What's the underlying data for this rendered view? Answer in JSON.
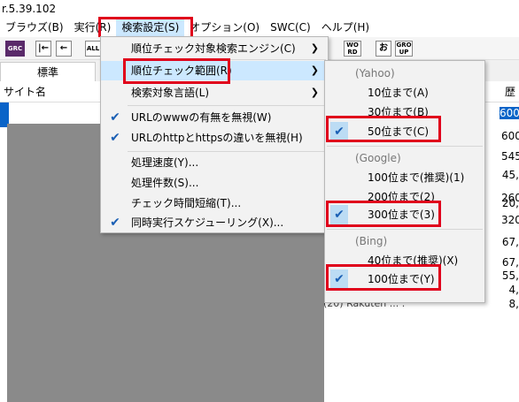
{
  "title": "r.5.39.102",
  "menubar": [
    {
      "label": "ブラウズ(B)"
    },
    {
      "label": "実行(R)"
    },
    {
      "label": "検索設定(S)"
    },
    {
      "label": "オプション(O)"
    },
    {
      "label": "SWC(C)"
    },
    {
      "label": "ヘルプ(H)"
    }
  ],
  "toolbar": {
    "grc_label": "GRC",
    "all_label": "ALL",
    "word_label": "WO RD",
    "o_label": "お",
    "group_label": "GRO UP"
  },
  "tab": {
    "label": "標準"
  },
  "header": {
    "site_name": "サイト名",
    "right_partial": "歴"
  },
  "rows_right": [
    "600,",
    "600,",
    "545,",
    "45,",
    "260,",
    "20,",
    "320,",
    "67,",
    "67,",
    "55,",
    "4,",
    "8,"
  ],
  "main_menu": {
    "items": [
      {
        "label": "順位チェック対象検索エンジン(C)",
        "submenu": true,
        "checked": false
      },
      {
        "label": "順位チェック範囲(R)",
        "submenu": true,
        "checked": false
      },
      {
        "label": "検索対象言語(L)",
        "submenu": true,
        "checked": false
      },
      {
        "label": "URLのwwwの有無を無視(W)",
        "submenu": false,
        "checked": true
      },
      {
        "label": "URLのhttpとhttpsの違いを無視(H)",
        "submenu": false,
        "checked": true
      },
      {
        "label": "処理速度(Y)...",
        "submenu": false,
        "checked": false
      },
      {
        "label": "処理件数(S)...",
        "submenu": false,
        "checked": false
      },
      {
        "label": "チェック時間短縮(T)...",
        "submenu": false,
        "checked": false
      },
      {
        "label": "同時実行スケジューリング(X)...",
        "submenu": false,
        "checked": true
      }
    ]
  },
  "sub_menu": {
    "yahoo_header": "(Yahoo)",
    "yahoo": [
      {
        "label": "10位まで(A)",
        "checked": false
      },
      {
        "label": "30位まで(B)",
        "checked": false
      },
      {
        "label": "50位まで(C)",
        "checked": true
      }
    ],
    "google_header": "(Google)",
    "google": [
      {
        "label": "100位まで(推奨)(1)",
        "checked": false
      },
      {
        "label": "200位まで(2)",
        "checked": false
      },
      {
        "label": "300位まで(3)",
        "checked": true
      }
    ],
    "bing_header": "(Bing)",
    "bing": [
      {
        "label": "40位まで(推奨)(X)",
        "checked": false
      },
      {
        "label": "100位まで(Y)",
        "checked": true
      }
    ]
  },
  "bottom_text": "(20) Rakuten ... ."
}
